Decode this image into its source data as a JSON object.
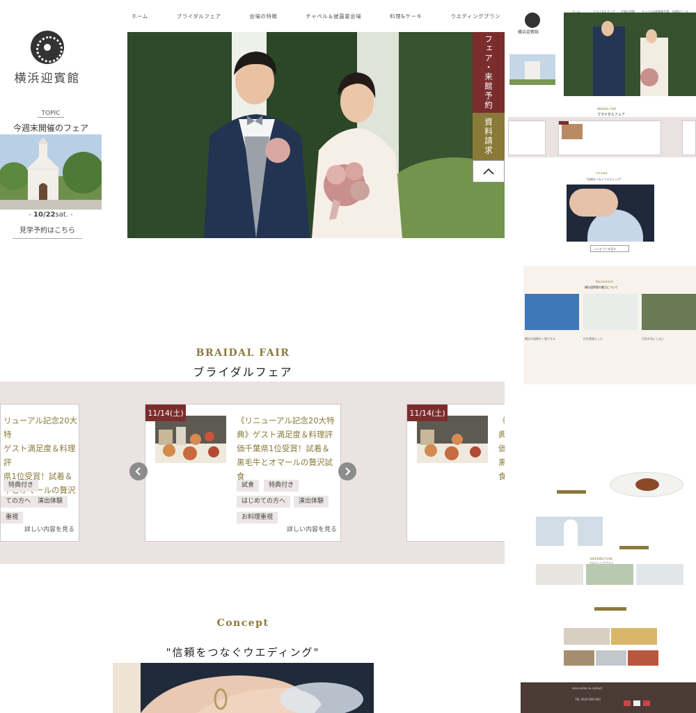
{
  "brand": {
    "name": "横浜迎賓館"
  },
  "nav": {
    "items": [
      "ホーム",
      "ブライダルフェア",
      "会場の特徴",
      "チャペル＆披露宴会場",
      "料理&ケーキ",
      "ウエディングプラン"
    ]
  },
  "sidebar": {
    "topic_label": "TOPIC",
    "topic_title": "今週末開催のフェア",
    "date_value": "10/22",
    "date_day": "sat.",
    "link": "見学予約はこちら"
  },
  "cta": {
    "fair": "フェア・来館予約",
    "docs": "資料請求"
  },
  "bridal_fair": {
    "heading_en": "BRAIDAL FAIR",
    "heading_jp": "ブライダルフェア",
    "cards": [
      {
        "badge": "11/14(土)",
        "title_lines": [
          "《リニューアル記念20大特",
          "典》ゲスト満足度＆料理評",
          "価千葉県1位受賞！試着＆",
          "黒毛牛とオマールの贅沢試",
          "食"
        ],
        "tags": [
          "試食",
          "特典付き",
          "はじめての方へ",
          "演出体験",
          "お料理重視"
        ],
        "more": "詳しい内容を見る"
      }
    ],
    "partial_left": {
      "title_lines": [
        "リューアル記念20大特",
        "ゲスト満足度＆料理評",
        "県1位受賞！試着＆",
        "牛とオマールの贅沢試"
      ],
      "tags": [
        "特典付き",
        "ての方へ",
        "演出体験",
        "重視"
      ],
      "more": "詳しい内容を見る"
    },
    "partial_right": {
      "badge": "11/14(土)",
      "title_lines": [
        "《",
        "典",
        "価",
        "黒",
        "食"
      ]
    }
  },
  "concept": {
    "heading_en": "Concept",
    "heading_jp": "\"信頼をつなぐウエディング\""
  },
  "mini_page": {
    "brand": "横浜迎賓館",
    "nav": [
      "ホーム",
      "ブライダルフェア",
      "会場の特徴",
      "チャペル&披露宴会場",
      "料理&ケーキ"
    ],
    "fair_heading_en": "BRAIDAL FAIR",
    "fair_heading_jp": "ブライダルフェア",
    "concept_heading": "Concept",
    "concept_sub": "\"信頼をつなぐウエディング\"",
    "concept_btn": "コンセプトを見る",
    "recommend_en": "Recommend",
    "recommend_jp": "横浜迎賓館の魅力について",
    "recommend_items": [
      "横浜の風景を一望できる",
      "白を基調とした",
      "天気を気にしない"
    ],
    "plan_en": "WEDDING PLAN",
    "plan_jp": "ウエディングプラン",
    "contact_en": "reservation & contact",
    "contact_tel": "TEL 0120-000-000"
  },
  "colors": {
    "accent": "#8a7a3a",
    "fair_btn": "#7b2d2d",
    "band": "#ebe2e2"
  }
}
